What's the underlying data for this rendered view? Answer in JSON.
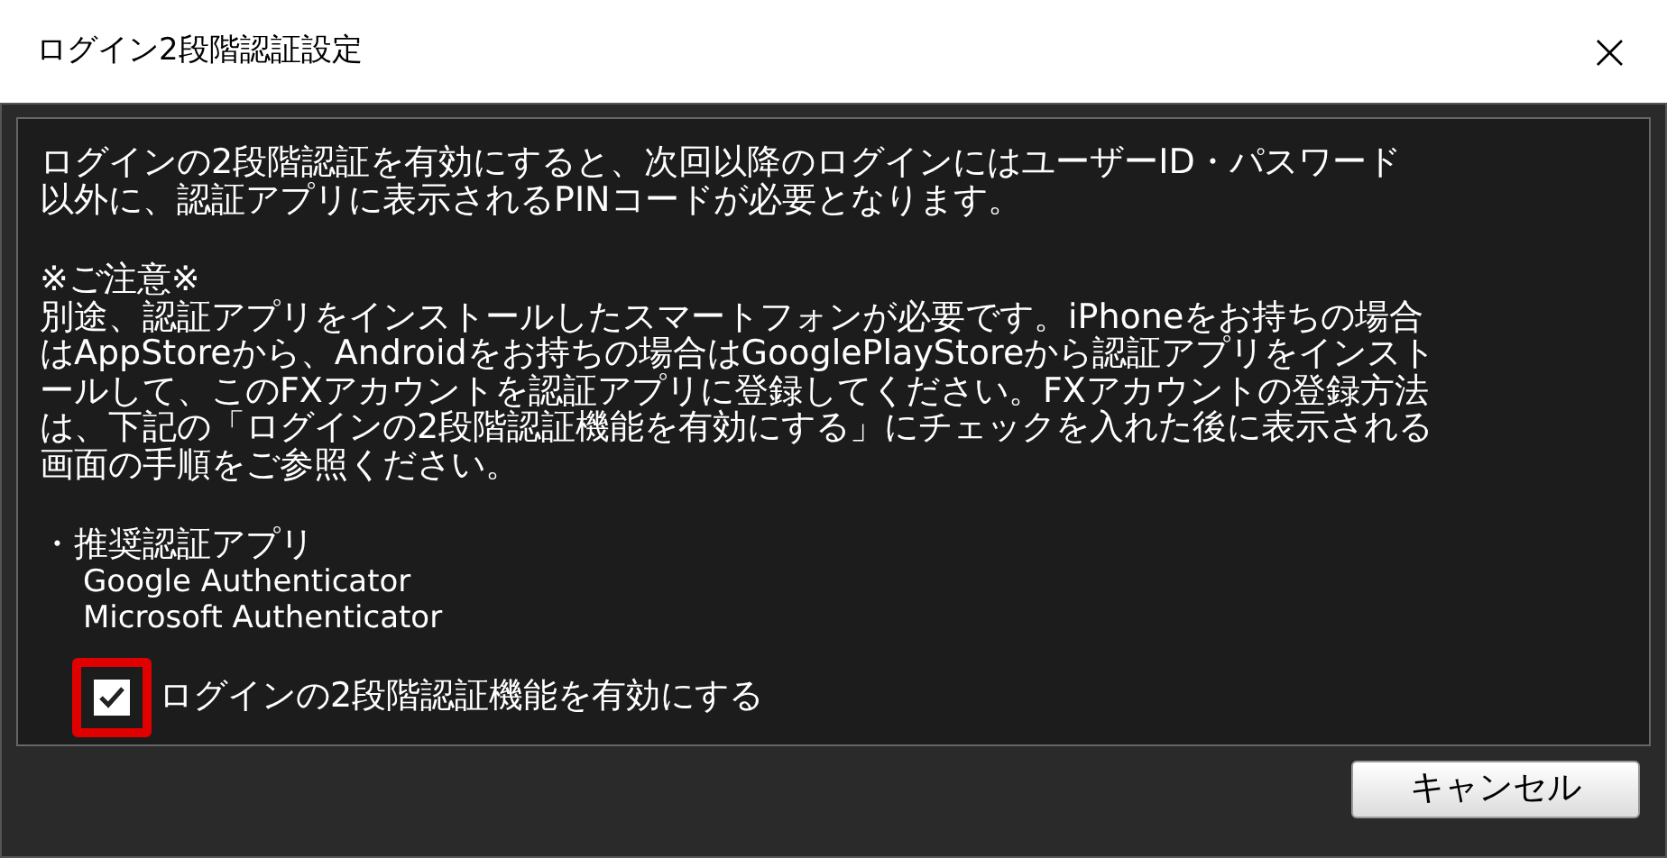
{
  "window": {
    "title": "ログイン2段階認証設定",
    "close": "×"
  },
  "paragraphs": [
    [
      "ログインの2段階認証を有効にすると、次回以降のログインにはユーザーID・パスワード",
      "以外に、認証アプリに表示されるPINコードが必要となります。"
    ],
    [
      "※ご注意※",
      "別途、認証アプリをインストールしたスマートフォンが必要です。iPhoneをお持ちの場合",
      "はAppStoreから、Androidをお持ちの場合はGooglePlayStoreから認証アプリをインスト",
      "ールして、このFXアカウントを認証アプリに登録してください。FXアカウントの登録方法",
      "は、下記の「ログインの2段階認証機能を有効にする」にチェックを入れた後に表示される",
      "画面の手順をご参照ください。"
    ]
  ],
  "recommended": {
    "heading": "・推奨認証アプリ",
    "apps": [
      "Google Authenticator",
      "Microsoft Authenticator"
    ]
  },
  "checkbox": {
    "label": "ログインの2段階認証機能を有効にする",
    "checked": true,
    "highlighted": true
  },
  "buttons": [
    "キャンセル"
  ]
}
